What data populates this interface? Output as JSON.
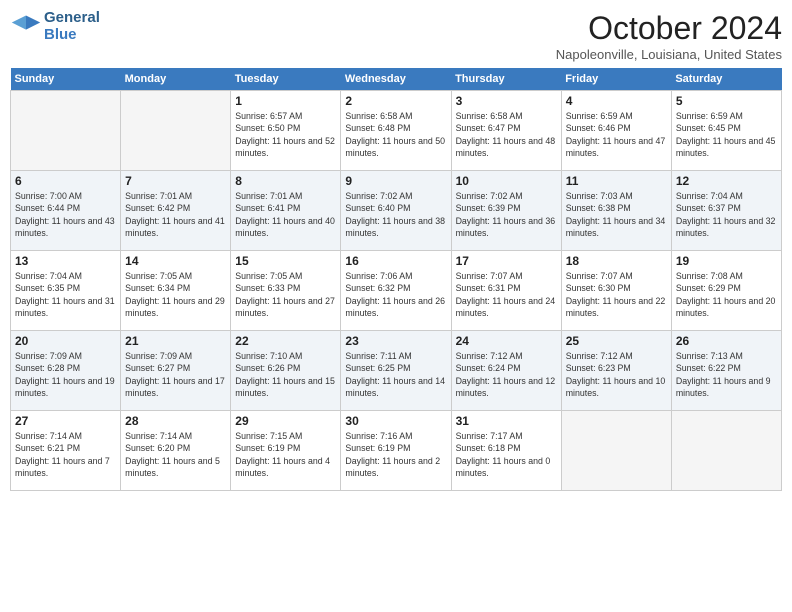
{
  "header": {
    "logo_line1": "General",
    "logo_line2": "Blue",
    "month": "October 2024",
    "location": "Napoleonville, Louisiana, United States"
  },
  "days_of_week": [
    "Sunday",
    "Monday",
    "Tuesday",
    "Wednesday",
    "Thursday",
    "Friday",
    "Saturday"
  ],
  "weeks": [
    [
      {
        "day": "",
        "empty": true
      },
      {
        "day": "",
        "empty": true
      },
      {
        "day": "1",
        "sunrise": "Sunrise: 6:57 AM",
        "sunset": "Sunset: 6:50 PM",
        "daylight": "Daylight: 11 hours and 52 minutes."
      },
      {
        "day": "2",
        "sunrise": "Sunrise: 6:58 AM",
        "sunset": "Sunset: 6:48 PM",
        "daylight": "Daylight: 11 hours and 50 minutes."
      },
      {
        "day": "3",
        "sunrise": "Sunrise: 6:58 AM",
        "sunset": "Sunset: 6:47 PM",
        "daylight": "Daylight: 11 hours and 48 minutes."
      },
      {
        "day": "4",
        "sunrise": "Sunrise: 6:59 AM",
        "sunset": "Sunset: 6:46 PM",
        "daylight": "Daylight: 11 hours and 47 minutes."
      },
      {
        "day": "5",
        "sunrise": "Sunrise: 6:59 AM",
        "sunset": "Sunset: 6:45 PM",
        "daylight": "Daylight: 11 hours and 45 minutes."
      }
    ],
    [
      {
        "day": "6",
        "sunrise": "Sunrise: 7:00 AM",
        "sunset": "Sunset: 6:44 PM",
        "daylight": "Daylight: 11 hours and 43 minutes."
      },
      {
        "day": "7",
        "sunrise": "Sunrise: 7:01 AM",
        "sunset": "Sunset: 6:42 PM",
        "daylight": "Daylight: 11 hours and 41 minutes."
      },
      {
        "day": "8",
        "sunrise": "Sunrise: 7:01 AM",
        "sunset": "Sunset: 6:41 PM",
        "daylight": "Daylight: 11 hours and 40 minutes."
      },
      {
        "day": "9",
        "sunrise": "Sunrise: 7:02 AM",
        "sunset": "Sunset: 6:40 PM",
        "daylight": "Daylight: 11 hours and 38 minutes."
      },
      {
        "day": "10",
        "sunrise": "Sunrise: 7:02 AM",
        "sunset": "Sunset: 6:39 PM",
        "daylight": "Daylight: 11 hours and 36 minutes."
      },
      {
        "day": "11",
        "sunrise": "Sunrise: 7:03 AM",
        "sunset": "Sunset: 6:38 PM",
        "daylight": "Daylight: 11 hours and 34 minutes."
      },
      {
        "day": "12",
        "sunrise": "Sunrise: 7:04 AM",
        "sunset": "Sunset: 6:37 PM",
        "daylight": "Daylight: 11 hours and 32 minutes."
      }
    ],
    [
      {
        "day": "13",
        "sunrise": "Sunrise: 7:04 AM",
        "sunset": "Sunset: 6:35 PM",
        "daylight": "Daylight: 11 hours and 31 minutes."
      },
      {
        "day": "14",
        "sunrise": "Sunrise: 7:05 AM",
        "sunset": "Sunset: 6:34 PM",
        "daylight": "Daylight: 11 hours and 29 minutes."
      },
      {
        "day": "15",
        "sunrise": "Sunrise: 7:05 AM",
        "sunset": "Sunset: 6:33 PM",
        "daylight": "Daylight: 11 hours and 27 minutes."
      },
      {
        "day": "16",
        "sunrise": "Sunrise: 7:06 AM",
        "sunset": "Sunset: 6:32 PM",
        "daylight": "Daylight: 11 hours and 26 minutes."
      },
      {
        "day": "17",
        "sunrise": "Sunrise: 7:07 AM",
        "sunset": "Sunset: 6:31 PM",
        "daylight": "Daylight: 11 hours and 24 minutes."
      },
      {
        "day": "18",
        "sunrise": "Sunrise: 7:07 AM",
        "sunset": "Sunset: 6:30 PM",
        "daylight": "Daylight: 11 hours and 22 minutes."
      },
      {
        "day": "19",
        "sunrise": "Sunrise: 7:08 AM",
        "sunset": "Sunset: 6:29 PM",
        "daylight": "Daylight: 11 hours and 20 minutes."
      }
    ],
    [
      {
        "day": "20",
        "sunrise": "Sunrise: 7:09 AM",
        "sunset": "Sunset: 6:28 PM",
        "daylight": "Daylight: 11 hours and 19 minutes."
      },
      {
        "day": "21",
        "sunrise": "Sunrise: 7:09 AM",
        "sunset": "Sunset: 6:27 PM",
        "daylight": "Daylight: 11 hours and 17 minutes."
      },
      {
        "day": "22",
        "sunrise": "Sunrise: 7:10 AM",
        "sunset": "Sunset: 6:26 PM",
        "daylight": "Daylight: 11 hours and 15 minutes."
      },
      {
        "day": "23",
        "sunrise": "Sunrise: 7:11 AM",
        "sunset": "Sunset: 6:25 PM",
        "daylight": "Daylight: 11 hours and 14 minutes."
      },
      {
        "day": "24",
        "sunrise": "Sunrise: 7:12 AM",
        "sunset": "Sunset: 6:24 PM",
        "daylight": "Daylight: 11 hours and 12 minutes."
      },
      {
        "day": "25",
        "sunrise": "Sunrise: 7:12 AM",
        "sunset": "Sunset: 6:23 PM",
        "daylight": "Daylight: 11 hours and 10 minutes."
      },
      {
        "day": "26",
        "sunrise": "Sunrise: 7:13 AM",
        "sunset": "Sunset: 6:22 PM",
        "daylight": "Daylight: 11 hours and 9 minutes."
      }
    ],
    [
      {
        "day": "27",
        "sunrise": "Sunrise: 7:14 AM",
        "sunset": "Sunset: 6:21 PM",
        "daylight": "Daylight: 11 hours and 7 minutes."
      },
      {
        "day": "28",
        "sunrise": "Sunrise: 7:14 AM",
        "sunset": "Sunset: 6:20 PM",
        "daylight": "Daylight: 11 hours and 5 minutes."
      },
      {
        "day": "29",
        "sunrise": "Sunrise: 7:15 AM",
        "sunset": "Sunset: 6:19 PM",
        "daylight": "Daylight: 11 hours and 4 minutes."
      },
      {
        "day": "30",
        "sunrise": "Sunrise: 7:16 AM",
        "sunset": "Sunset: 6:19 PM",
        "daylight": "Daylight: 11 hours and 2 minutes."
      },
      {
        "day": "31",
        "sunrise": "Sunrise: 7:17 AM",
        "sunset": "Sunset: 6:18 PM",
        "daylight": "Daylight: 11 hours and 0 minutes."
      },
      {
        "day": "",
        "empty": true
      },
      {
        "day": "",
        "empty": true
      }
    ]
  ]
}
